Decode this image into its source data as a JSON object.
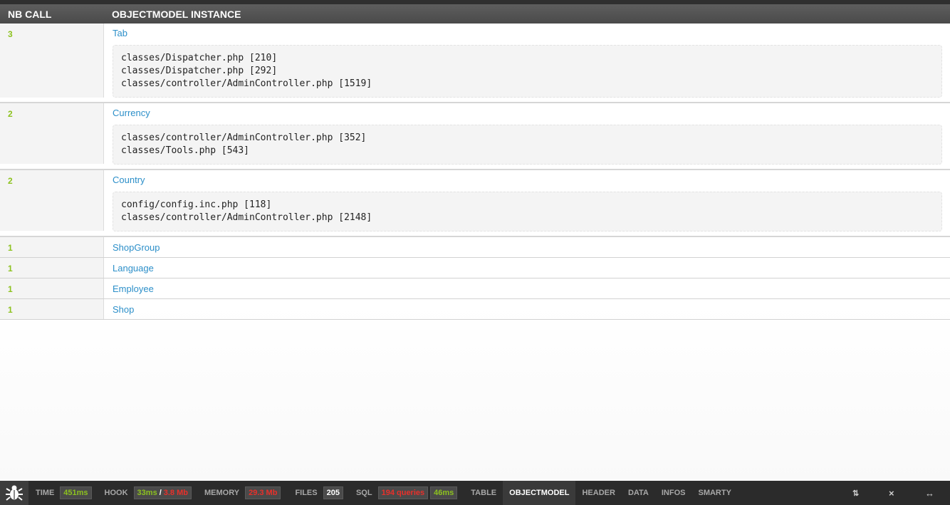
{
  "table": {
    "header": {
      "calls": "NB CALL",
      "instance": "OBJECTMODEL INSTANCE"
    },
    "rows": [
      {
        "count": "3",
        "name": "Tab",
        "trace": [
          "classes/Dispatcher.php [210]",
          "classes/Dispatcher.php [292]",
          "classes/controller/AdminController.php [1519]"
        ]
      },
      {
        "count": "2",
        "name": "Currency",
        "trace": [
          "classes/controller/AdminController.php [352]",
          "classes/Tools.php [543]"
        ]
      },
      {
        "count": "2",
        "name": "Country",
        "trace": [
          "config/config.inc.php [118]",
          "classes/controller/AdminController.php [2148]"
        ]
      },
      {
        "count": "1",
        "name": "ShopGroup"
      },
      {
        "count": "1",
        "name": "Language"
      },
      {
        "count": "1",
        "name": "Employee"
      },
      {
        "count": "1",
        "name": "Shop"
      }
    ]
  },
  "toolbar": {
    "logo_icon": "bug-icon",
    "time": {
      "label": "TIME",
      "value": "451ms"
    },
    "hook": {
      "label": "HOOK",
      "time": "33ms",
      "separator": "/",
      "memory": "3.8 Mb"
    },
    "memory": {
      "label": "MEMORY",
      "value": "29.3 Mb"
    },
    "files": {
      "label": "FILES",
      "value": "205"
    },
    "sql": {
      "label": "SQL",
      "queries": "194 queries",
      "time": "46ms"
    },
    "tabs": [
      "TABLE",
      "OBJECTMODEL",
      "HEADER",
      "DATA",
      "INFOS",
      "SMARTY"
    ],
    "active_tab": "OBJECTMODEL",
    "controls": {
      "swap": "⇅",
      "close": "×",
      "expand": "↔"
    }
  },
  "colors": {
    "count_green": "#8dc21f",
    "link_blue": "#2c8fc9",
    "alert_red": "#e8302a",
    "bar_bg": "#2b2b2b"
  }
}
